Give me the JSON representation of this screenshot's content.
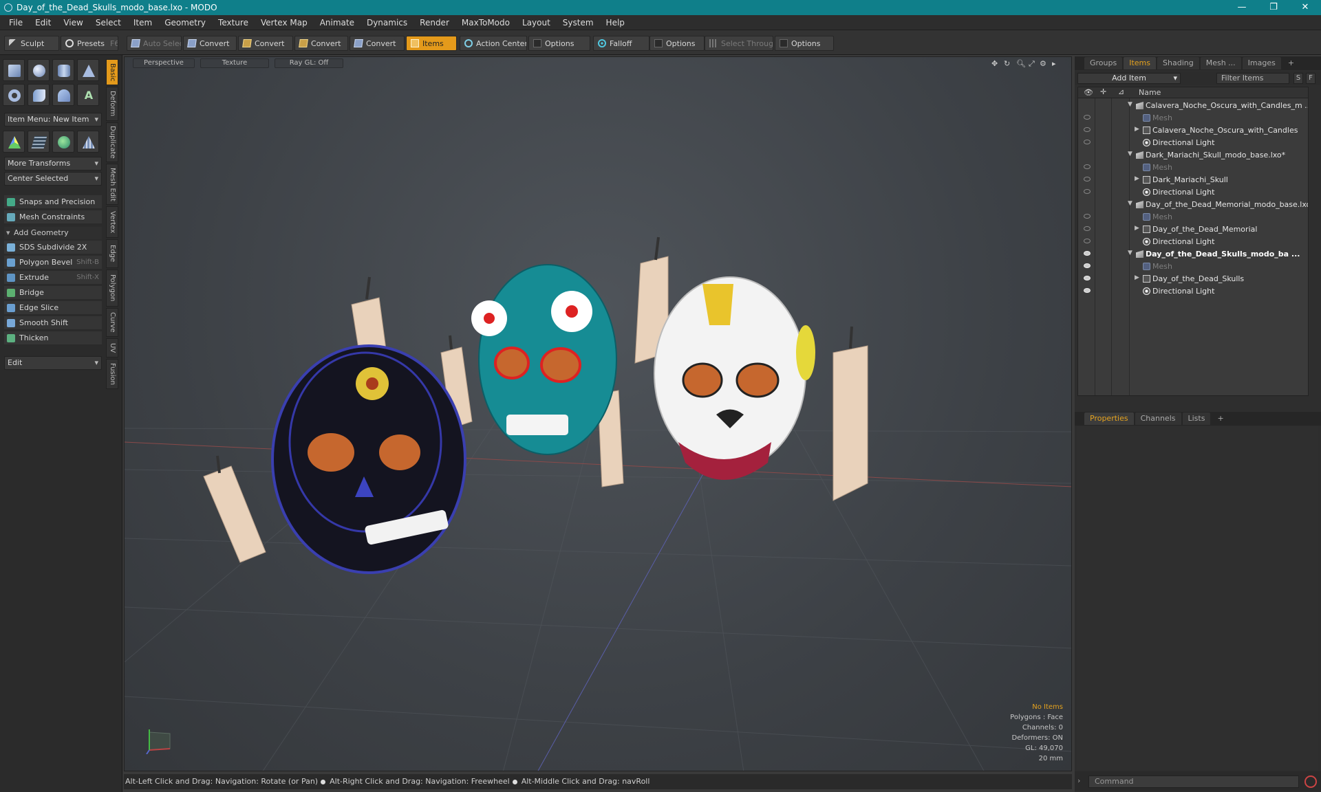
{
  "window": {
    "title": "Day_of_the_Dead_Skulls_modo_base.lxo - MODO",
    "minimize": "—",
    "maximize": "❐",
    "close": "✕"
  },
  "menu": [
    "File",
    "Edit",
    "View",
    "Select",
    "Item",
    "Geometry",
    "Texture",
    "Vertex Map",
    "Animate",
    "Dynamics",
    "Render",
    "MaxToModo",
    "Layout",
    "System",
    "Help"
  ],
  "toolbar": {
    "sculpt": "Sculpt",
    "presets": "Presets",
    "presets_key": "F6",
    "auto_select": "Auto Select",
    "convert1": "Convert",
    "convert2": "Convert",
    "convert3": "Convert",
    "convert4": "Convert",
    "items": "Items",
    "action_center": "Action Center",
    "options1": "Options",
    "falloff": "Falloff",
    "options2": "Options",
    "select_through": "Select Through",
    "options3": "Options"
  },
  "left": {
    "item_menu": "Item Menu: New Item",
    "more_transforms": "More Transforms",
    "center_selected": "Center Selected",
    "snaps": "Snaps and Precision",
    "mesh_constraints": "Mesh Constraints",
    "add_geometry": "Add Geometry",
    "tools": [
      {
        "label": "SDS Subdivide 2X",
        "key": ""
      },
      {
        "label": "Polygon Bevel",
        "key": "Shift-B"
      },
      {
        "label": "Extrude",
        "key": "Shift-X"
      },
      {
        "label": "Bridge",
        "key": ""
      },
      {
        "label": "Edge Slice",
        "key": ""
      },
      {
        "label": "Smooth Shift",
        "key": ""
      },
      {
        "label": "Thicken",
        "key": ""
      }
    ],
    "edit": "Edit",
    "vtabs": [
      "Basic",
      "Deform",
      "Duplicate",
      "Mesh Edit",
      "Vertex",
      "Edge",
      "Polygon",
      "Curve",
      "UV",
      "Fusion"
    ]
  },
  "viewport": {
    "perspective": "Perspective",
    "texture": "Texture",
    "raygl": "Ray GL: Off",
    "info": {
      "no_items": "No Items",
      "polygons": "Polygons : Face",
      "channels": "Channels: 0",
      "deformers": "Deformers: ON",
      "gl": "GL: 49,070",
      "scale": "20 mm"
    }
  },
  "status": {
    "hint1": "Alt-Left Click and Drag: Navigation: Rotate (or Pan)",
    "hint2": "Alt-Right Click and Drag: Navigation: Freewheel",
    "hint3": "Alt-Middle Click and Drag: navRoll"
  },
  "right": {
    "tabs": [
      "Groups",
      "Items",
      "Shading",
      "Mesh ...",
      "Images"
    ],
    "add_item": "Add Item",
    "filter": "Filter Items",
    "s_btn": "S",
    "f_btn": "F",
    "name_col": "Name",
    "tree": [
      {
        "label": "Calavera_Noche_Oscura_with_Candles_m ...",
        "type": "scene",
        "level": 0,
        "exp": "▼",
        "eye": false,
        "style": ""
      },
      {
        "label": "Mesh",
        "type": "mesh",
        "level": 1,
        "exp": "",
        "eye": false,
        "style": "dim"
      },
      {
        "label": "Calavera_Noche_Oscura_with_Candles",
        "type": "group",
        "level": 1,
        "exp": "▶",
        "eye": false,
        "style": ""
      },
      {
        "label": "Directional Light",
        "type": "light",
        "level": 1,
        "exp": "",
        "eye": false,
        "style": ""
      },
      {
        "label": "Dark_Mariachi_Skull_modo_base.lxo*",
        "type": "scene",
        "level": 0,
        "exp": "▼",
        "eye": false,
        "style": ""
      },
      {
        "label": "Mesh",
        "type": "mesh",
        "level": 1,
        "exp": "",
        "eye": false,
        "style": "dim"
      },
      {
        "label": "Dark_Mariachi_Skull",
        "type": "group",
        "level": 1,
        "exp": "▶",
        "eye": false,
        "style": ""
      },
      {
        "label": "Directional Light",
        "type": "light",
        "level": 1,
        "exp": "",
        "eye": false,
        "style": ""
      },
      {
        "label": "Day_of_the_Dead_Memorial_modo_base.lxo",
        "type": "scene",
        "level": 0,
        "exp": "▼",
        "eye": false,
        "style": ""
      },
      {
        "label": "Mesh",
        "type": "mesh",
        "level": 1,
        "exp": "",
        "eye": false,
        "style": "dim"
      },
      {
        "label": "Day_of_the_Dead_Memorial",
        "type": "group",
        "level": 1,
        "exp": "▶",
        "eye": false,
        "style": ""
      },
      {
        "label": "Directional Light",
        "type": "light",
        "level": 1,
        "exp": "",
        "eye": false,
        "style": ""
      },
      {
        "label": "Day_of_the_Dead_Skulls_modo_ba ...",
        "type": "scene",
        "level": 0,
        "exp": "▼",
        "eye": true,
        "style": "bold"
      },
      {
        "label": "Mesh",
        "type": "mesh",
        "level": 1,
        "exp": "",
        "eye": true,
        "style": "dim"
      },
      {
        "label": "Day_of_the_Dead_Skulls",
        "type": "group",
        "level": 1,
        "exp": "▶",
        "eye": true,
        "style": ""
      },
      {
        "label": "Directional Light",
        "type": "light",
        "level": 1,
        "exp": "",
        "eye": true,
        "style": ""
      }
    ],
    "prop_tabs": [
      "Properties",
      "Channels",
      "Lists"
    ],
    "command": "Command"
  },
  "colors": {
    "accent": "#e49a1b",
    "title_bar": "#0f7f8a"
  }
}
